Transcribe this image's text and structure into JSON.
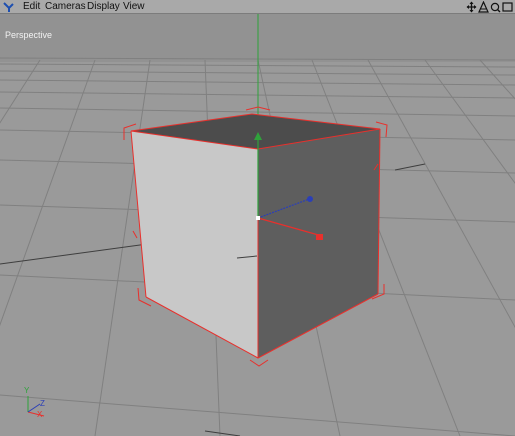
{
  "menubar": {
    "items": [
      {
        "label": "Edit"
      },
      {
        "label": "Cameras"
      },
      {
        "label": "Display"
      },
      {
        "label": "View"
      }
    ],
    "tool_icons": [
      "move-view-icon",
      "rotate-view-icon",
      "zoom-view-icon",
      "toggle-layout-icon"
    ]
  },
  "viewport": {
    "label": "Perspective",
    "background_color": "#9a9a9a",
    "grid_color": "#7e7e7e",
    "selection_color": "#e8302c"
  },
  "axis_widget": {
    "y": "Y",
    "z": "Z",
    "x": "X"
  }
}
